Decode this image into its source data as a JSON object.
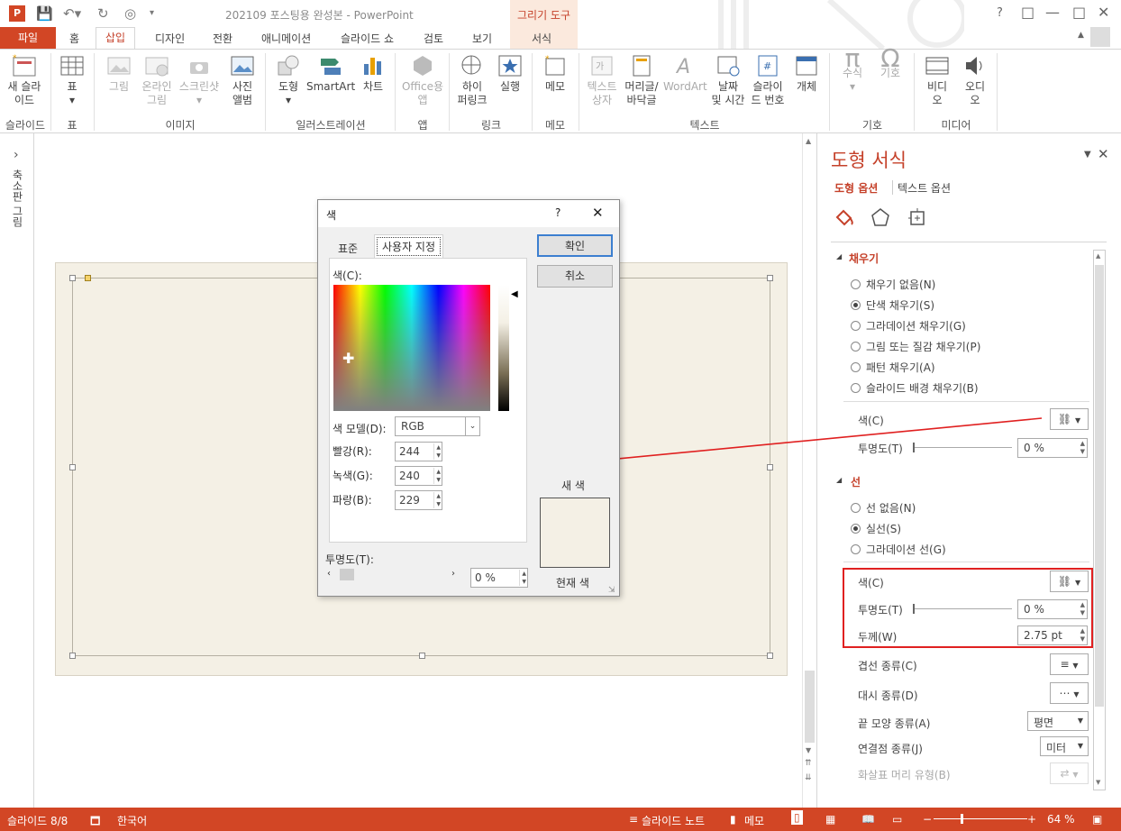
{
  "titlebar": {
    "title": "202109 포스팅용 완성본 - PowerPoint",
    "contextual": "그리기 도구",
    "help": "?"
  },
  "tabs": [
    "파일",
    "홈",
    "삽입",
    "디자인",
    "전환",
    "애니메이션",
    "슬라이드 쇼",
    "검토",
    "보기",
    "서식"
  ],
  "ribbon": {
    "new_slide": "새 슬라\n이드",
    "table": "표",
    "picture": "그림",
    "online_picture": "온라인\n그림",
    "screenshot": "스크린샷",
    "photo_album": "사진\n앨범",
    "shapes": "도형",
    "smartart": "SmartArt",
    "chart": "차트",
    "office_apps": "Office용\n앱",
    "hyperlink": "하이\n퍼링크",
    "action": "실행",
    "comment": "메모",
    "textbox": "텍스트\n상자",
    "header_footer": "머리글/\n바닥글",
    "wordart": "WordArt",
    "datetime": "날짜\n및 시간",
    "slide_number": "슬라이\n드 번호",
    "object": "개체",
    "equation": "수식",
    "symbol": "기호",
    "video": "비디\n오",
    "audio": "오디\n오",
    "groups": {
      "slides": "슬라이드",
      "tables": "표",
      "images": "이미지",
      "illustrations": "일러스트레이션",
      "apps": "앱",
      "links": "링크",
      "comments": "메모",
      "text": "텍스트",
      "symbols": "기호",
      "media": "미디어"
    }
  },
  "leftstrip": {
    "label": "축소판 그림",
    "arrow": "›"
  },
  "pane": {
    "title": "도형 서식",
    "tab_shape": "도형 옵션",
    "tab_text": "텍스트 옵션",
    "fill_section": "채우기",
    "fill_options": [
      {
        "label": "채우기 없음(N)",
        "selected": false
      },
      {
        "label": "단색 채우기(S)",
        "selected": true
      },
      {
        "label": "그라데이션 채우기(G)",
        "selected": false
      },
      {
        "label": "그림 또는 질감 채우기(P)",
        "selected": false
      },
      {
        "label": "패턴 채우기(A)",
        "selected": false
      },
      {
        "label": "슬라이드 배경 채우기(B)",
        "selected": false
      }
    ],
    "fill_color_label": "색(C)",
    "fill_transparency_label": "투명도(T)",
    "fill_transparency_value": "0 %",
    "line_section": "선",
    "line_options": [
      {
        "label": "선 없음(N)",
        "selected": false
      },
      {
        "label": "실선(S)",
        "selected": true
      },
      {
        "label": "그라데이션 선(G)",
        "selected": false
      }
    ],
    "line_color_label": "색(C)",
    "line_transparency_label": "투명도(T)",
    "line_transparency_value": "0 %",
    "width_label": "두께(W)",
    "width_value": "2.75 pt",
    "compound_label": "겹선 종류(C)",
    "dash_label": "대시 종류(D)",
    "cap_label": "끝 모양 종류(A)",
    "cap_value": "평면",
    "join_label": "연결점 종류(J)",
    "join_value": "미터",
    "arrow_label": "화살표 머리 유형(B)"
  },
  "dialog": {
    "title": "색",
    "help": "?",
    "tab_standard": "표준",
    "tab_custom": "사용자 지정",
    "colors_label": "색(C):",
    "model_label": "색 모델(D):",
    "model_value": "RGB",
    "red_label": "빨강(R):",
    "red_value": "244",
    "green_label": "녹색(G):",
    "green_value": "240",
    "blue_label": "파랑(B):",
    "blue_value": "229",
    "ok": "확인",
    "cancel": "취소",
    "new_label": "새 색",
    "current_label": "현재 색",
    "transparency_label": "투명도(T):",
    "transparency_value": "0 %",
    "new_color": "#f4f0e5",
    "current_color": "#f4f0e5"
  },
  "status": {
    "slide": "슬라이드 8/8",
    "language": "한국어",
    "notes": "슬라이드 노트",
    "comments": "메모",
    "zoom": "64 %"
  },
  "colors": {
    "accent": "#d24625",
    "title_accent": "#c5412a",
    "highlight": "#e02020",
    "slide_bg": "#f4f0e5"
  }
}
